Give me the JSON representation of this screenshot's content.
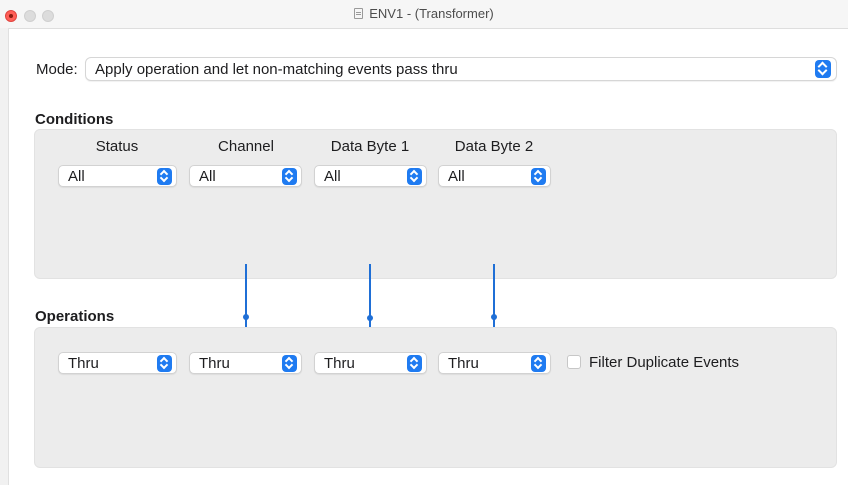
{
  "window": {
    "title": "ENV1 - (Transformer)"
  },
  "mode": {
    "label": "Mode:",
    "value": "Apply operation and let non-matching events pass thru"
  },
  "conditions": {
    "title": "Conditions",
    "columns": [
      {
        "header": "Status",
        "value": "All"
      },
      {
        "header": "Channel",
        "value": "All"
      },
      {
        "header": "Data Byte 1",
        "value": "All"
      },
      {
        "header": "Data Byte 2",
        "value": "All"
      }
    ]
  },
  "operations": {
    "title": "Operations",
    "values": [
      "Thru",
      "Thru",
      "Thru",
      "Thru"
    ],
    "filter_duplicates_label": "Filter Duplicate Events",
    "filter_duplicates_checked": false
  },
  "colors": {
    "accent": "#1f7bf1",
    "connector": "#1f6fd6",
    "panel": "#ececec"
  }
}
